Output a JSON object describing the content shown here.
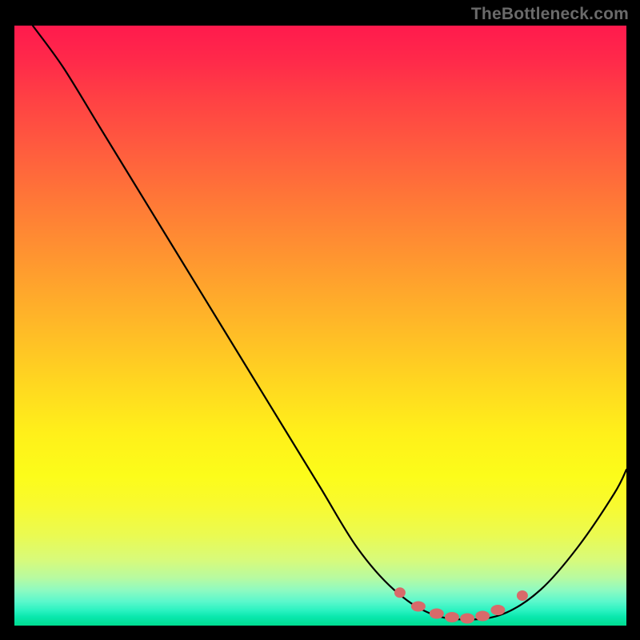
{
  "attribution": "TheBottleneck.com",
  "chart_data": {
    "type": "line",
    "title": "",
    "xlabel": "",
    "ylabel": "",
    "xlim": [
      0,
      100
    ],
    "ylim": [
      0,
      100
    ],
    "curve": [
      {
        "x": 3,
        "y": 100
      },
      {
        "x": 8,
        "y": 93
      },
      {
        "x": 14,
        "y": 83
      },
      {
        "x": 20,
        "y": 73
      },
      {
        "x": 26,
        "y": 63
      },
      {
        "x": 32,
        "y": 53
      },
      {
        "x": 38,
        "y": 43
      },
      {
        "x": 44,
        "y": 33
      },
      {
        "x": 50,
        "y": 23
      },
      {
        "x": 56,
        "y": 13
      },
      {
        "x": 62,
        "y": 6
      },
      {
        "x": 68,
        "y": 2
      },
      {
        "x": 74,
        "y": 1
      },
      {
        "x": 80,
        "y": 2
      },
      {
        "x": 86,
        "y": 6
      },
      {
        "x": 92,
        "y": 13
      },
      {
        "x": 98,
        "y": 22
      },
      {
        "x": 100,
        "y": 26
      }
    ],
    "highlight_points": [
      {
        "x": 63,
        "y": 5.5
      },
      {
        "x": 66,
        "y": 3.2
      },
      {
        "x": 69,
        "y": 2.0
      },
      {
        "x": 71.5,
        "y": 1.4
      },
      {
        "x": 74,
        "y": 1.2
      },
      {
        "x": 76.5,
        "y": 1.6
      },
      {
        "x": 79,
        "y": 2.6
      },
      {
        "x": 83,
        "y": 5.0
      }
    ],
    "gradient_stops": [
      {
        "pos": 0,
        "color": "#ff1a4d"
      },
      {
        "pos": 50,
        "color": "#ffc024"
      },
      {
        "pos": 80,
        "color": "#f8fa30"
      },
      {
        "pos": 100,
        "color": "#00dc90"
      }
    ]
  }
}
